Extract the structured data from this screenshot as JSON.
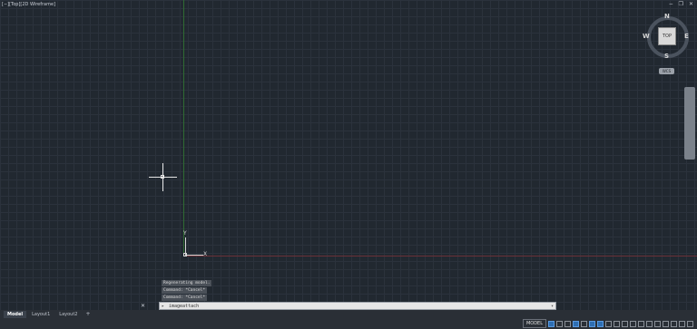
{
  "viewport": {
    "view_controls": "[−][Top][2D Wireframe]",
    "window_controls": "− ❐ ✕"
  },
  "viewcube": {
    "north": "N",
    "south": "S",
    "east": "E",
    "west": "W",
    "face": "TOP",
    "wcs": "WCS"
  },
  "ucs": {
    "x_label": "X",
    "y_label": "Y"
  },
  "command_history": [
    "Regenerating model.",
    "Command: *Cancel*",
    "Command: *Cancel*"
  ],
  "command_line": {
    "value": "imageattach",
    "icons": "✕ 🔧"
  },
  "layout_tabs": [
    "Model",
    "Layout1",
    "Layout2"
  ],
  "add_tab": "+",
  "status": {
    "model_label": "MODEL",
    "icons": [
      "grid-icon",
      "snap-icon",
      "ortho-icon",
      "polar-icon",
      "isodraft-icon",
      "osnap-icon",
      "otrack-icon",
      "annotation-visibility-icon",
      "annotation-scale-icon",
      "workspace-icon",
      "annotation-monitor-icon",
      "units-icon",
      "quick-properties-icon",
      "lock-ui-icon",
      "isolate-objects-icon",
      "hardware-acceleration-icon",
      "clean-screen-icon",
      "customize-icon"
    ]
  },
  "colors": {
    "canvas": "#212830",
    "y_axis": "#2f6b32",
    "x_axis": "#6a3037"
  }
}
